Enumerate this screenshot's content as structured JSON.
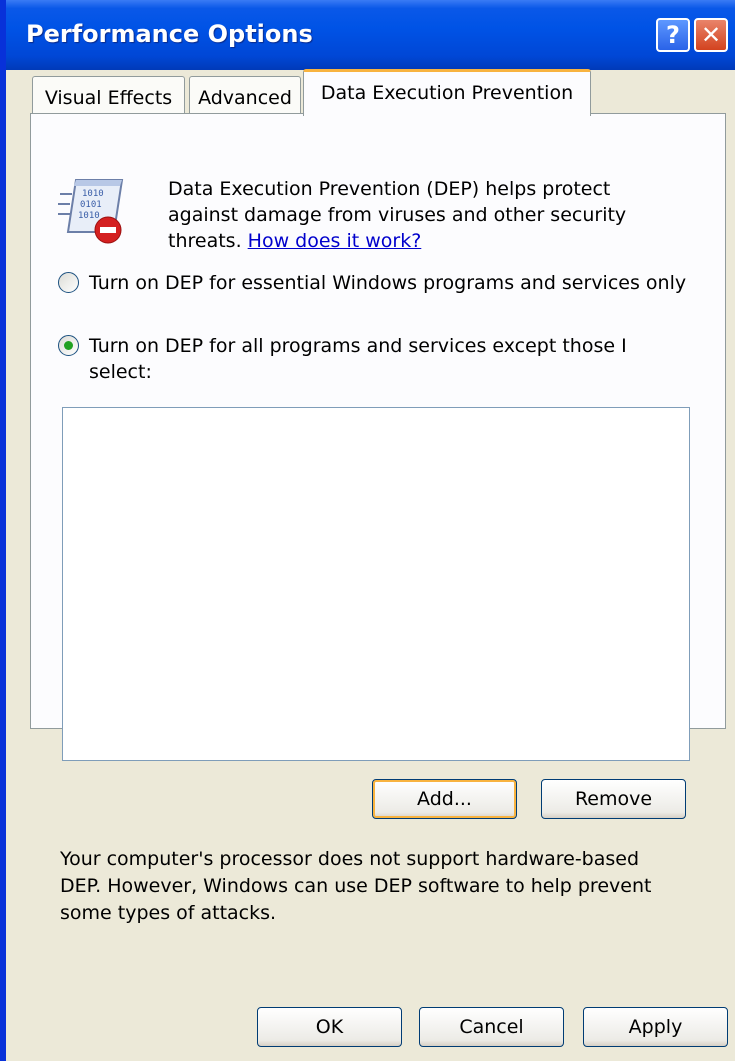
{
  "window": {
    "title": "Performance Options"
  },
  "titlebar": {
    "help_glyph": "?",
    "close_glyph": "✕"
  },
  "tabs": [
    {
      "label": "Visual Effects",
      "selected": false
    },
    {
      "label": "Advanced",
      "selected": false
    },
    {
      "label": "Data Execution Prevention",
      "selected": true
    }
  ],
  "dep": {
    "intro_text": "Data Execution Prevention (DEP) helps protect against damage from viruses and other security threats. ",
    "help_link": "How does it work?",
    "option_essential": {
      "label": "Turn on DEP for essential Windows programs and services only",
      "selected": false
    },
    "option_all": {
      "label": "Turn on DEP for all programs and services except those I select:",
      "selected": true
    },
    "exceptions_list": [],
    "add_label": "Add...",
    "remove_label": "Remove",
    "note": "Your computer's processor does not support hardware-based DEP. However, Windows can use DEP software to help prevent some types of attacks."
  },
  "footer": {
    "ok_label": "OK",
    "cancel_label": "Cancel",
    "apply_label": "Apply"
  },
  "icons": {
    "dep_icon": "dep-shield-binary-icon"
  },
  "colors": {
    "title_bar": "#0053e6",
    "window_border": "#0831d9",
    "tab_highlight": "#f8b33f",
    "link": "#0000cc"
  }
}
